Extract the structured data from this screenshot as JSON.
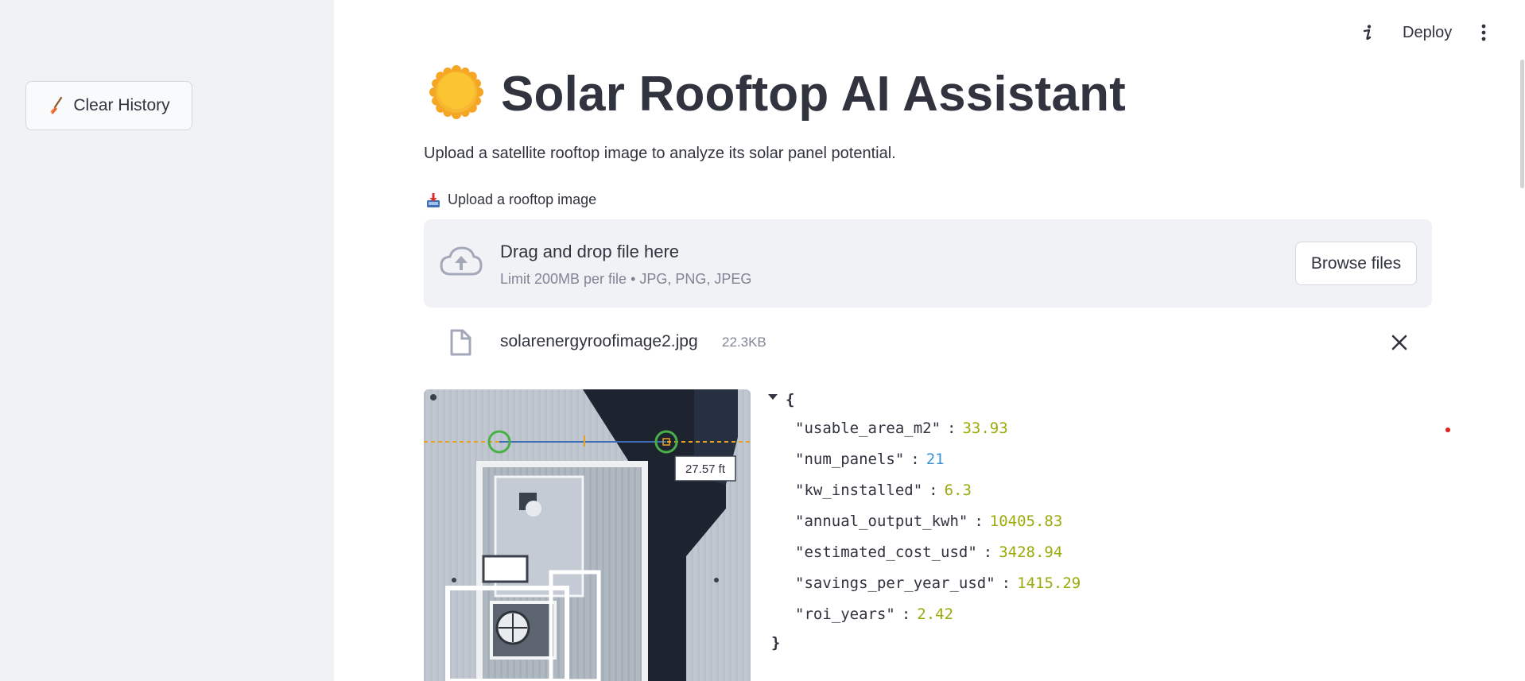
{
  "sidebar": {
    "clear_button": {
      "label": "Clear History",
      "icon": "broom-icon"
    }
  },
  "header": {
    "info_icon": "info-icon",
    "deploy_label": "Deploy",
    "menu_icon": "kebab-menu-icon"
  },
  "main": {
    "title": "Solar Rooftop AI Assistant",
    "title_icon": "sun-icon",
    "subtitle": "Upload a satellite rooftop image to analyze its solar panel potential.",
    "uploader": {
      "label": "Upload a rooftop image",
      "label_icon": "inbox-tray-icon",
      "drop_title": "Drag and drop file here",
      "drop_subtitle": "Limit 200MB per file • JPG, PNG, JPEG",
      "browse_label": "Browse files"
    },
    "file": {
      "name": "solarenergyroofimage2.jpg",
      "size": "22.3KB"
    },
    "image": {
      "measurement_label": "27.57 ft"
    },
    "json_result": {
      "open_brace": "{",
      "close_brace": "}",
      "rows": [
        {
          "key": "\"usable_area_m2\"",
          "value": "33.93",
          "type": "float"
        },
        {
          "key": "\"num_panels\"",
          "value": "21",
          "type": "int"
        },
        {
          "key": "\"kw_installed\"",
          "value": "6.3",
          "type": "float"
        },
        {
          "key": "\"annual_output_kwh\"",
          "value": "10405.83",
          "type": "float"
        },
        {
          "key": "\"estimated_cost_usd\"",
          "value": "3428.94",
          "type": "float"
        },
        {
          "key": "\"savings_per_year_usd\"",
          "value": "1415.29",
          "type": "float"
        },
        {
          "key": "\"roi_years\"",
          "value": "2.42",
          "type": "float"
        }
      ]
    }
  },
  "colors": {
    "sidebar_bg": "#f0f2f6",
    "text": "#31333f",
    "muted": "#808495",
    "json_float": "#9aab0c",
    "json_int": "#3a94d2"
  }
}
